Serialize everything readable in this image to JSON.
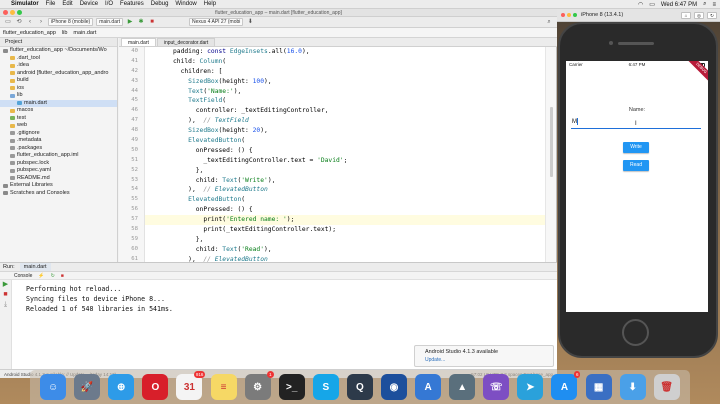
{
  "menubar": {
    "apple": "",
    "items": [
      "Simulator",
      "File",
      "Edit",
      "Device",
      "I/O",
      "Features",
      "Debug",
      "Window",
      "Help"
    ],
    "clock": "Wed 6:47 PM"
  },
  "ide": {
    "title": "flutter_education_app – main.dart [flutter_education_app]",
    "toolbar": {
      "device": "iPhone 8 (mobile)",
      "config": "main.dart",
      "avd": "Nexus 4 API 27 (mobi"
    },
    "breadcrumbs": [
      "flutter_education_app",
      "lib",
      "main.dart"
    ],
    "project": {
      "header": "Project",
      "items": [
        {
          "label": "flutter_education_app  ~/Documents/Wo",
          "depth": 0,
          "color": "#8a8a8a"
        },
        {
          "label": ".dart_tool",
          "depth": 1,
          "color": "#e8b84a"
        },
        {
          "label": ".idea",
          "depth": 1,
          "color": "#e8b84a"
        },
        {
          "label": "android  [flutter_education_app_andro",
          "depth": 1,
          "color": "#e8b84a"
        },
        {
          "label": "build",
          "depth": 1,
          "color": "#e8b84a"
        },
        {
          "label": "ios",
          "depth": 1,
          "color": "#e8b84a"
        },
        {
          "label": "lib",
          "depth": 1,
          "color": "#7aa7d8"
        },
        {
          "label": "main.dart",
          "depth": 2,
          "color": "#54a4d8",
          "selected": true
        },
        {
          "label": "macos",
          "depth": 1,
          "color": "#e8b84a"
        },
        {
          "label": "test",
          "depth": 1,
          "color": "#78b25a"
        },
        {
          "label": "web",
          "depth": 1,
          "color": "#e8b84a"
        },
        {
          "label": ".gitignore",
          "depth": 1,
          "color": "#999999"
        },
        {
          "label": ".metadata",
          "depth": 1,
          "color": "#999999"
        },
        {
          "label": ".packages",
          "depth": 1,
          "color": "#999999"
        },
        {
          "label": "flutter_education_app.iml",
          "depth": 1,
          "color": "#999999"
        },
        {
          "label": "pubspec.lock",
          "depth": 1,
          "color": "#999999"
        },
        {
          "label": "pubspec.yaml",
          "depth": 1,
          "color": "#999999"
        },
        {
          "label": "README.md",
          "depth": 1,
          "color": "#999999"
        },
        {
          "label": "External Libraries",
          "depth": 0,
          "color": "#8a8a8a"
        },
        {
          "label": "Scratches and Consoles",
          "depth": 0,
          "color": "#8a8a8a"
        }
      ]
    },
    "tabs": [
      "main.dart",
      "input_decorator.dart"
    ],
    "code": {
      "line_numbers": [
        "40",
        "41",
        "42",
        "43",
        "44",
        "45",
        "46",
        "47",
        "48",
        "49",
        "50",
        "51",
        "52",
        "53",
        "54",
        "55",
        "56",
        "57",
        "58",
        "59",
        "60",
        "61"
      ],
      "lines": [
        "padding: const EdgeInsets.all(16.0),",
        "child: Column(",
        "  children: [",
        "    SizedBox(height: 100),",
        "    Text('Name:'),",
        "    TextField(",
        "      controller: _textEditingController,",
        "    ),  // TextField",
        "    SizedBox(height: 20),",
        "    ElevatedButton(",
        "      onPressed: () {",
        "        _textEditingController.text = 'David';",
        "      },",
        "      child: Text('Write'),",
        "    ),  // ElevatedButton",
        "    ElevatedButton(",
        "      onPressed: () {",
        "        print('Entered name: ');",
        "        print(_textEditingController.text);",
        "      },",
        "      child: Text('Read'),",
        "    ),  // ElevatedButton"
      ],
      "trailing": [
        "  ],"
      ]
    },
    "run": {
      "tab_label": "Run:",
      "tab_config": "main.dart",
      "sub_tab": "Console",
      "output": [
        "Performing hot reload...",
        "Syncing files to device iPhone 8...",
        "Reloaded 1 of 548 libraries in 541ms."
      ]
    },
    "notification": {
      "title": "Android Studio 4.1.3 available",
      "action": "Update..."
    },
    "status": {
      "left": "Android Studio 4.1.3 available: // Update... (today 14:13)",
      "right": "57:02   LF   UTF-8   2 spaces   Dart   base_app"
    }
  },
  "simulator": {
    "title": "iPhone 8 (13.4.1)",
    "status_bar": {
      "carrier": "Carrier",
      "time": "6:47 PM"
    },
    "debug_banner": "DEBUG",
    "app": {
      "label": "Name:",
      "field_value": "M",
      "write_button": "Write",
      "read_button": "Read"
    }
  },
  "dock": {
    "apps": [
      {
        "name": "finder",
        "color": "#3d8ce8",
        "glyph": "☺"
      },
      {
        "name": "launchpad",
        "color": "#6c7a8c",
        "glyph": "🚀"
      },
      {
        "name": "safari",
        "color": "#2d9be8",
        "glyph": "⊕"
      },
      {
        "name": "opera",
        "color": "#d81f2a",
        "glyph": "O"
      },
      {
        "name": "calendar",
        "color": "#f4f4f4",
        "glyph": "31",
        "badge": "916"
      },
      {
        "name": "notes",
        "color": "#f6d865",
        "glyph": "≡"
      },
      {
        "name": "system-preferences",
        "color": "#7b7b7b",
        "glyph": "⚙",
        "badge": "1"
      },
      {
        "name": "terminal",
        "color": "#222222",
        "glyph": ">_"
      },
      {
        "name": "skype",
        "color": "#16a6e8",
        "glyph": "S"
      },
      {
        "name": "quicktime",
        "color": "#2d3a4a",
        "glyph": "Q"
      },
      {
        "name": "sourcetree",
        "color": "#1d4f9c",
        "glyph": "◉"
      },
      {
        "name": "xcode",
        "color": "#3578d4",
        "glyph": "A"
      },
      {
        "name": "android-studio",
        "color": "#5a6f7c",
        "glyph": "▲"
      },
      {
        "name": "viber",
        "color": "#7d4ec3",
        "glyph": "☏"
      },
      {
        "name": "telegram",
        "color": "#2aa1db",
        "glyph": "➤"
      },
      {
        "name": "app-store",
        "color": "#1f8ef1",
        "glyph": "A",
        "badge": "6"
      },
      {
        "name": "simulator",
        "color": "#3a6fc3",
        "glyph": "▦"
      },
      {
        "name": "downloads",
        "color": "#4aa0e8",
        "glyph": "⬇"
      },
      {
        "name": "trash",
        "color": "#cfcfcf",
        "glyph": "🗑"
      }
    ]
  }
}
